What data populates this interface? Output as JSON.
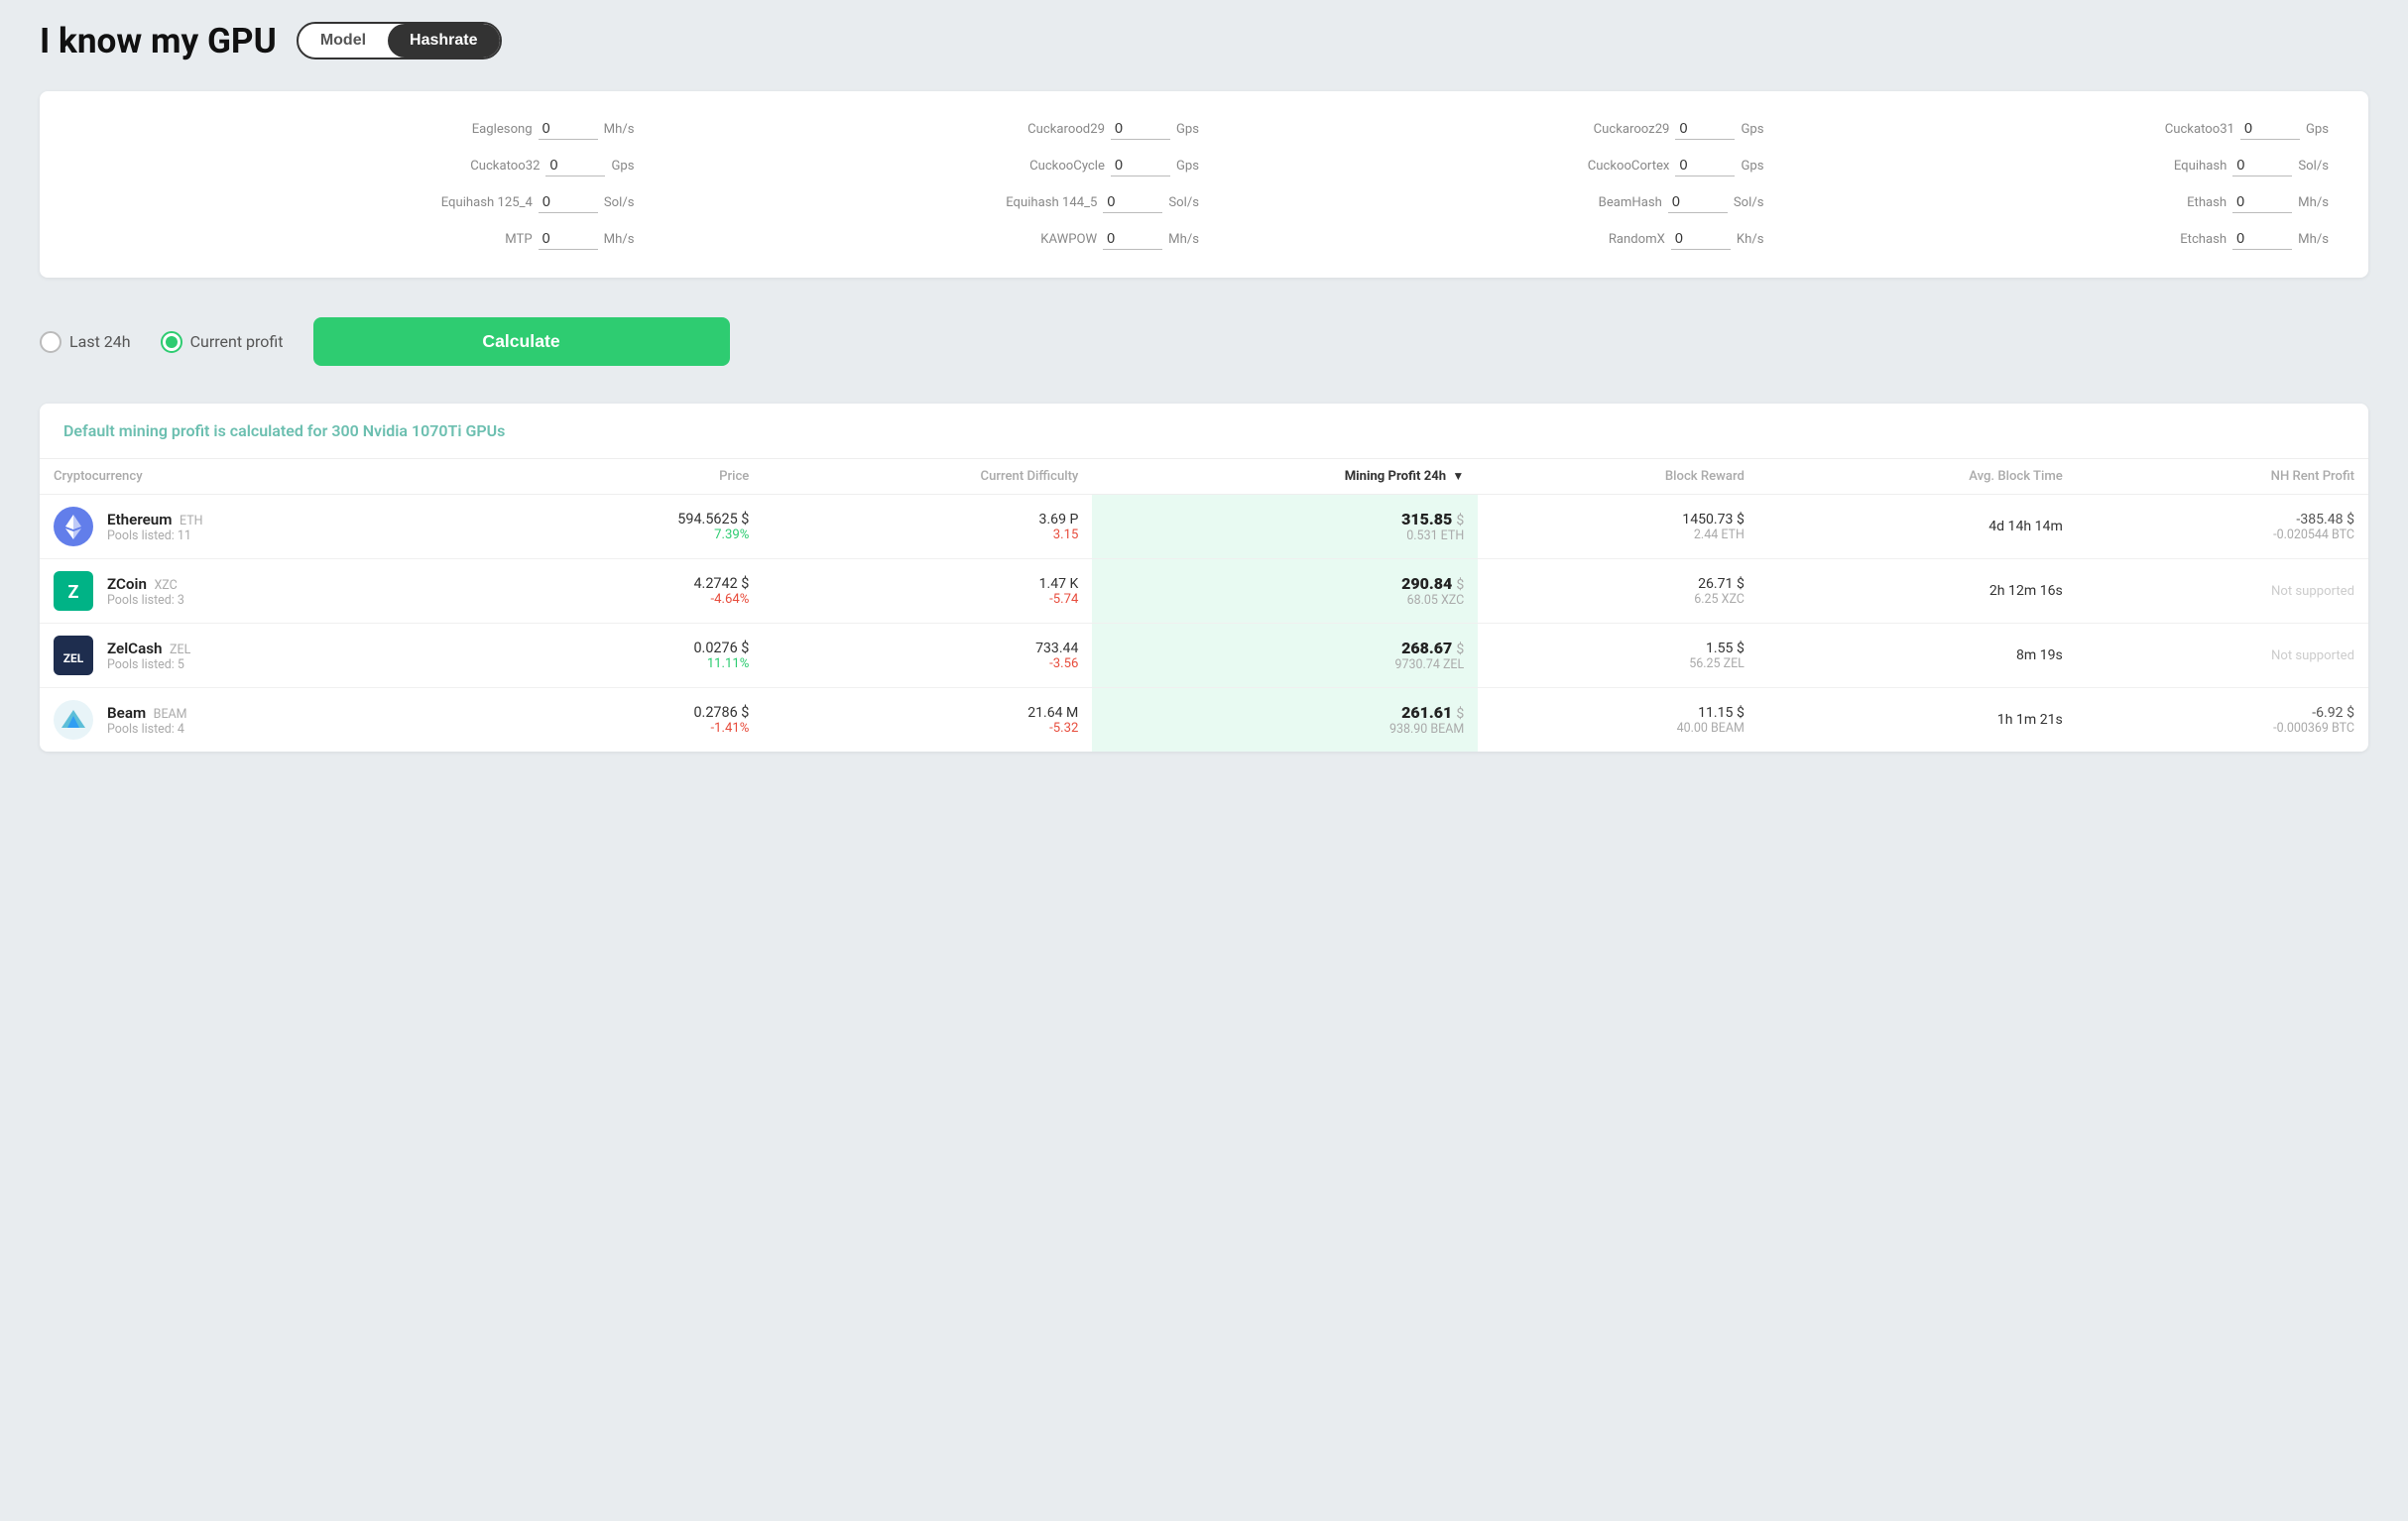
{
  "header": {
    "title": "I know my GPU",
    "toggle_model_label": "Model",
    "toggle_hashrate_label": "Hashrate",
    "active_toggle": "Hashrate"
  },
  "hashrate_fields": [
    {
      "label": "Eaglesong",
      "value": "0",
      "unit": "Mh/s"
    },
    {
      "label": "Cuckarood29",
      "value": "0",
      "unit": "Gps"
    },
    {
      "label": "Cuckarooz29",
      "value": "0",
      "unit": "Gps"
    },
    {
      "label": "Cuckatoo31",
      "value": "0",
      "unit": "Gps"
    },
    {
      "label": "Cuckatoo32",
      "value": "0",
      "unit": "Gps"
    },
    {
      "label": "CuckooCycle",
      "value": "0",
      "unit": "Gps"
    },
    {
      "label": "CuckooCortex",
      "value": "0",
      "unit": "Gps"
    },
    {
      "label": "Equihash",
      "value": "0",
      "unit": "Sol/s"
    },
    {
      "label": "Equihash 125_4",
      "value": "0",
      "unit": "Sol/s"
    },
    {
      "label": "Equihash 144_5",
      "value": "0",
      "unit": "Sol/s"
    },
    {
      "label": "BeamHash",
      "value": "0",
      "unit": "Sol/s"
    },
    {
      "label": "Ethash",
      "value": "0",
      "unit": "Mh/s"
    },
    {
      "label": "MTP",
      "value": "0",
      "unit": "Mh/s"
    },
    {
      "label": "KAWPOW",
      "value": "0",
      "unit": "Mh/s"
    },
    {
      "label": "RandomX",
      "value": "0",
      "unit": "Kh/s"
    },
    {
      "label": "Etchash",
      "value": "0",
      "unit": "Mh/s"
    }
  ],
  "controls": {
    "last24h_label": "Last 24h",
    "current_profit_label": "Current profit",
    "active": "current_profit",
    "calculate_label": "Calculate"
  },
  "results": {
    "header_text": "Default mining profit is calculated for 300 Nvidia 1070Ti GPUs",
    "table_headers": {
      "cryptocurrency": "Cryptocurrency",
      "price": "Price",
      "current_difficulty": "Current Difficulty",
      "mining_profit": "Mining Profit 24h",
      "block_reward": "Block Reward",
      "avg_block_time": "Avg. Block Time",
      "nh_rent_profit": "NH Rent Profit"
    },
    "rows": [
      {
        "icon": "ETH",
        "icon_color": "#627EEA",
        "name": "Ethereum",
        "ticker": "ETH",
        "pools": "Pools listed: 11",
        "price_main": "594.5625 $",
        "price_change": "7.39%",
        "price_positive": true,
        "diff_main": "3.69 P",
        "diff_change": "3.15",
        "diff_positive": false,
        "profit_main": "315.85",
        "profit_dollar": "$",
        "profit_sub": "0.531 ETH",
        "block_main": "1450.73 $",
        "block_sub": "2.44 ETH",
        "avg_block_time": "4d 14h 14m",
        "nh_main": "-385.48 $",
        "nh_sub": "-0.020544 BTC",
        "nh_supported": true
      },
      {
        "icon": "XZC",
        "icon_color": "#00B386",
        "name": "ZCoin",
        "ticker": "XZC",
        "pools": "Pools listed: 3",
        "price_main": "4.2742 $",
        "price_change": "-4.64%",
        "price_positive": false,
        "diff_main": "1.47 K",
        "diff_change": "-5.74",
        "diff_positive": false,
        "profit_main": "290.84",
        "profit_dollar": "$",
        "profit_sub": "68.05 XZC",
        "block_main": "26.71 $",
        "block_sub": "6.25 XZC",
        "avg_block_time": "2h 12m 16s",
        "nh_main": "",
        "nh_sub": "",
        "nh_supported": false
      },
      {
        "icon": "ZEL",
        "icon_color": "#1E2D4E",
        "name": "ZelCash",
        "ticker": "ZEL",
        "pools": "Pools listed: 5",
        "price_main": "0.0276 $",
        "price_change": "11.11%",
        "price_positive": true,
        "diff_main": "733.44",
        "diff_change": "-3.56",
        "diff_positive": false,
        "profit_main": "268.67",
        "profit_dollar": "$",
        "profit_sub": "9730.74 ZEL",
        "block_main": "1.55 $",
        "block_sub": "56.25 ZEL",
        "avg_block_time": "8m 19s",
        "nh_main": "",
        "nh_sub": "",
        "nh_supported": false
      },
      {
        "icon": "BEAM",
        "icon_color": "#00BFFF",
        "name": "Beam",
        "ticker": "BEAM",
        "pools": "Pools listed: 4",
        "price_main": "0.2786 $",
        "price_change": "-1.41%",
        "price_positive": false,
        "diff_main": "21.64 M",
        "diff_change": "-5.32",
        "diff_positive": false,
        "profit_main": "261.61",
        "profit_dollar": "$",
        "profit_sub": "938.90 BEAM",
        "block_main": "11.15 $",
        "block_sub": "40.00 BEAM",
        "avg_block_time": "1h 1m 21s",
        "nh_main": "-6.92 $",
        "nh_sub": "-0.000369 BTC",
        "nh_supported": true
      }
    ],
    "not_supported_label": "Not supported"
  }
}
